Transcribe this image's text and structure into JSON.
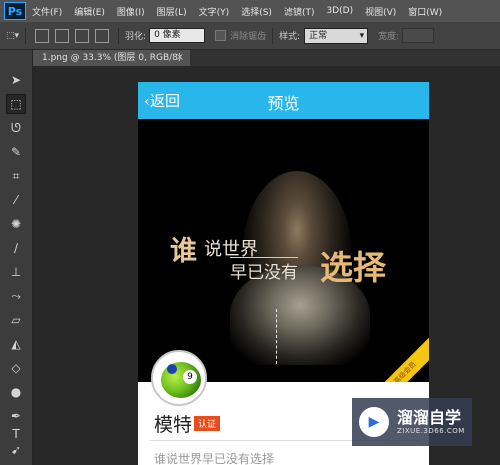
{
  "app": {
    "logo": "Ps"
  },
  "menu": [
    "文件(F)",
    "编辑(E)",
    "图像(I)",
    "图层(L)",
    "文字(Y)",
    "选择(S)",
    "滤镜(T)",
    "3D(D)",
    "视图(V)",
    "窗口(W)"
  ],
  "options": {
    "feather_label": "羽化:",
    "feather_value": "0 像素",
    "antialias_label": "消除锯齿",
    "style_label": "样式:",
    "style_value": "正常",
    "width_label": "宽度:"
  },
  "document_tab": {
    "label": "1.png @ 33.3% (图层 0, RGB/8)",
    "close": "×"
  },
  "phone": {
    "back_label": "‹返回",
    "title": "预览",
    "poster": {
      "line1": "谁",
      "line1b": "说世界",
      "line2": "早已没有",
      "line3": "选择",
      "ribbon": "高级会员"
    },
    "avatar_number": "9",
    "username": "模特",
    "badge": "认证",
    "subtext": "谁说世界早已没有选择"
  },
  "watermark": {
    "name": "溜溜自学",
    "url": "ZIXUE.3D66.COM"
  },
  "colors": {
    "header": "#29b6ea",
    "accent_gold": "#e9c796",
    "ribbon": "#f5c514",
    "ps_bg": "#282828"
  }
}
